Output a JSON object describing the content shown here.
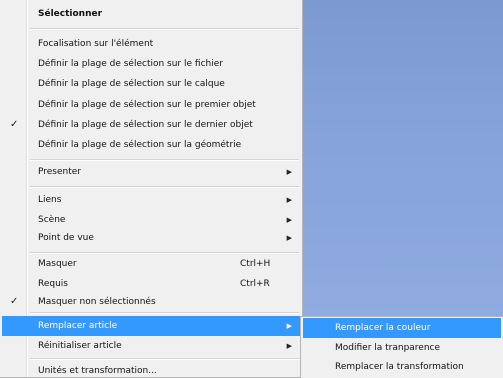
{
  "main_menu": {
    "header": "Sélectionner",
    "focus_item": "Focalisation sur l'élément",
    "selection_range_file": "Définir la plage de sélection sur le fichier",
    "selection_range_layer": "Définir la plage de sélection sur le calque",
    "selection_range_first_object": "Définir la plage de sélection sur le premier objet",
    "selection_range_last_object": "Définir la plage de sélection sur le dernier objet",
    "selection_range_geometry": "Définir la plage de sélection sur la géométrie",
    "presenter": "Presenter",
    "liens": "Liens",
    "scene": "Scène",
    "point_de_vue": "Point de vue",
    "masquer": "Masquer",
    "masquer_shortcut": "Ctrl+H",
    "requis": "Requis",
    "requis_shortcut": "Ctrl+R",
    "masquer_non_selectionnes": "Masquer non sélectionnés",
    "remplacer_article": "Remplacer article",
    "reinitialiser_article": "Réinitialiser article",
    "unites_transformation": "Unités et transformation..."
  },
  "submenu": {
    "remplacer_couleur": "Remplacer la couleur",
    "modifier_transparence": "Modifier la tranparence",
    "remplacer_transformation": "Remplacer la transformation"
  },
  "glyphs": {
    "check": "✓",
    "arrow": "▶"
  },
  "colors": {
    "highlight": "#3399ff",
    "menu_bg": "#f0f0f0",
    "desktop": "#86a4db"
  },
  "icons": [
    "check-icon",
    "submenu-arrow-icon"
  ]
}
